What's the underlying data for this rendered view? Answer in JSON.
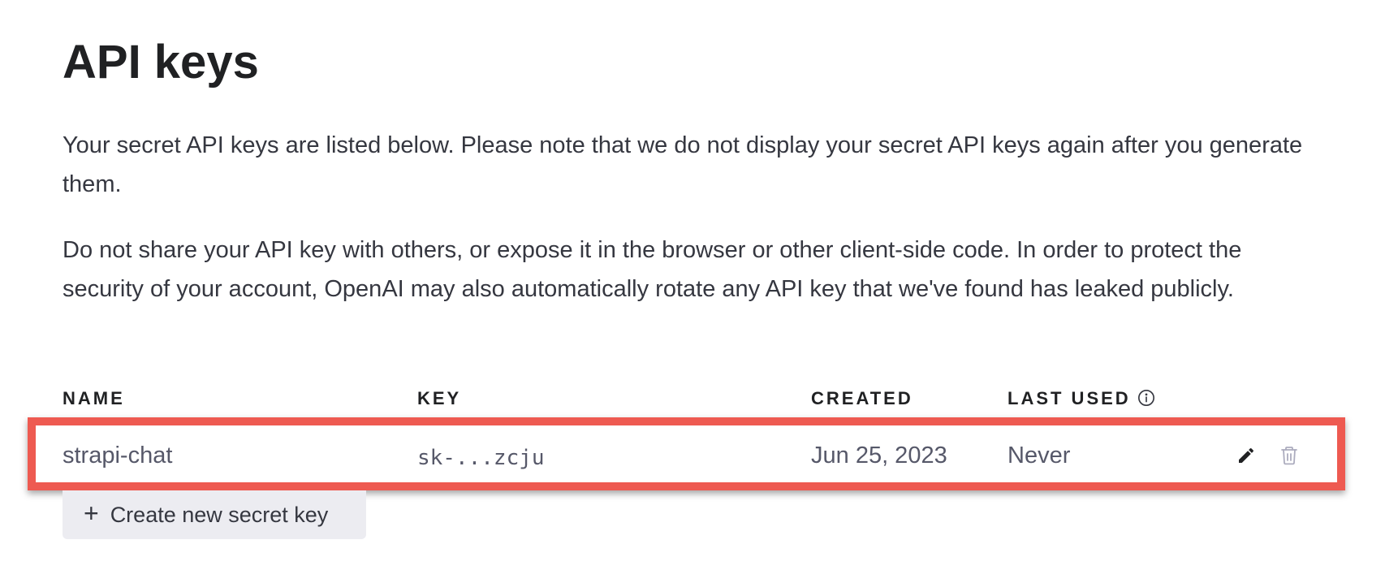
{
  "page": {
    "title": "API keys",
    "description_1": "Your secret API keys are listed below. Please note that we do not display your secret API keys again after you generate them.",
    "description_2": "Do not share your API key with others, or expose it in the browser or other client-side code. In order to protect the security of your account, OpenAI may also automatically rotate any API key that we've found has leaked publicly."
  },
  "table": {
    "headers": {
      "name": "NAME",
      "key": "KEY",
      "created": "CREATED",
      "last_used": "LAST USED"
    },
    "rows": [
      {
        "name": "strapi-chat",
        "key": "sk-...zcju",
        "created": "Jun 25, 2023",
        "last_used": "Never"
      }
    ]
  },
  "actions": {
    "create_label": "Create new secret key",
    "create_icon": "+"
  },
  "icons": {
    "info": "info-icon",
    "edit": "pencil-icon",
    "delete": "trash-icon"
  },
  "colors": {
    "highlight": "#ee5a51",
    "button_bg": "#ececf1",
    "text_primary": "#202123",
    "text_secondary": "#565869"
  }
}
